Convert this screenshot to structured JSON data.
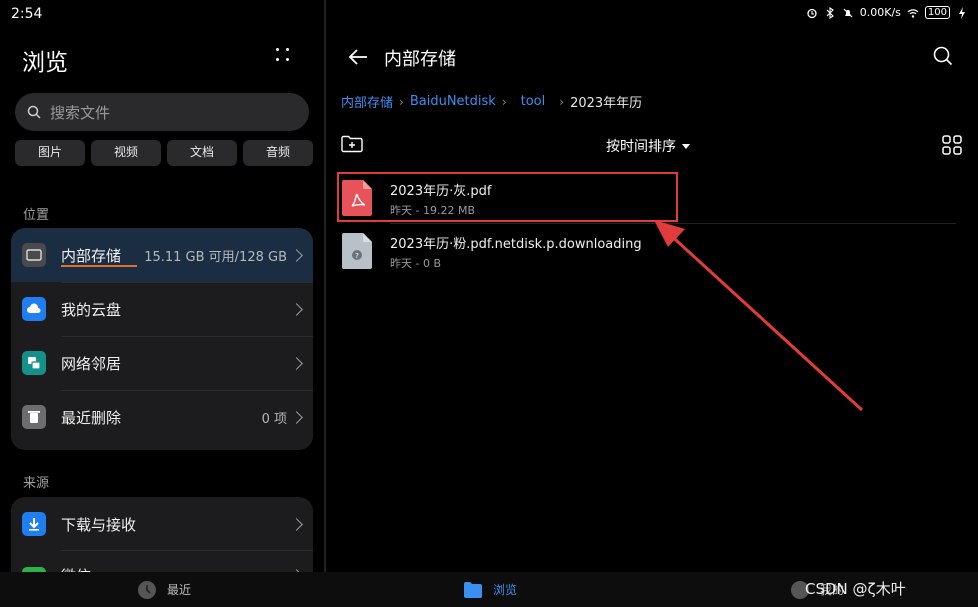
{
  "status_bar": {
    "time": "2:54",
    "speed": "0.00K/s",
    "battery": "100"
  },
  "left": {
    "title": "浏览",
    "search_placeholder": "搜索文件",
    "chips": [
      "图片",
      "视频",
      "文档",
      "音频"
    ],
    "location_label": "位置",
    "locations": [
      {
        "label": "内部存储",
        "value": "15.11 GB 可用/128 GB",
        "icon": "storage-icon",
        "color": "#4a4a4c"
      },
      {
        "label": "我的云盘",
        "value": "",
        "icon": "cloud-icon",
        "color": "#1f7ef0"
      },
      {
        "label": "网络邻居",
        "value": "",
        "icon": "network-icon",
        "color": "#15918a"
      },
      {
        "label": "最近删除",
        "value": "0 项",
        "icon": "trash-icon",
        "color": "#6d6d6f"
      }
    ],
    "source_label": "来源",
    "sources": [
      {
        "label": "下载与接收",
        "icon": "download-icon",
        "color": "#1f7ef0"
      },
      {
        "label": "微信",
        "icon": "wechat-icon",
        "color": "#2bb34a"
      }
    ]
  },
  "right": {
    "title": "内部存储",
    "breadcrumb": [
      "内部存储",
      "BaiduNetdisk",
      "tool"
    ],
    "breadcrumb_current": "2023年年历",
    "sort_label": "按时间排序",
    "files": [
      {
        "name": "2023年历·灰.pdf",
        "meta": "昨天 - 19.22 MB",
        "icon": "pdf-icon",
        "color": "#e8535a"
      },
      {
        "name": "2023年历·粉.pdf.netdisk.p.downloading",
        "meta": "昨天 - 0 B",
        "icon": "unknown-file-icon",
        "color": "#b8c0c8"
      }
    ]
  },
  "bottom_nav": {
    "recent": "最近",
    "browse": "浏览",
    "mine": "我的"
  },
  "watermark": "CSDN @ζ木叶"
}
